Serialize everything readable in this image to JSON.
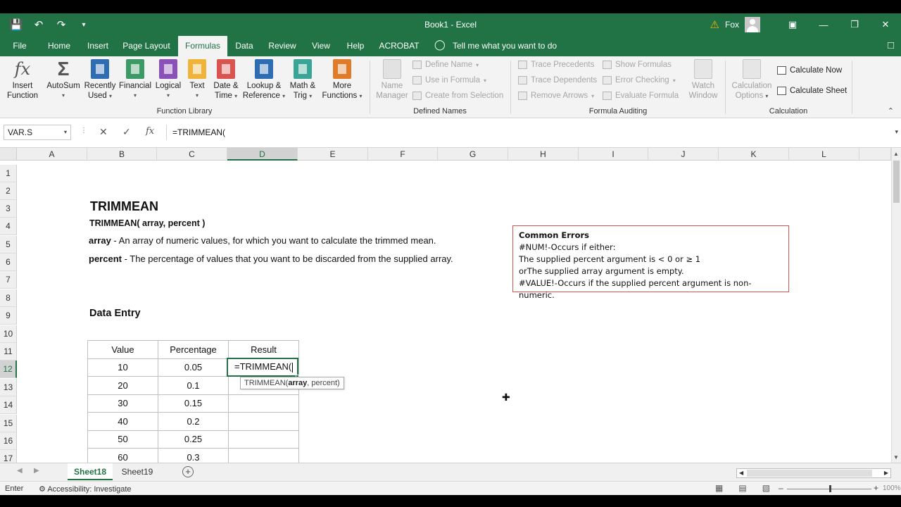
{
  "window": {
    "title": "Book1  -  Excel",
    "user": "Fox"
  },
  "tabs": [
    "File",
    "Home",
    "Insert",
    "Page Layout",
    "Formulas",
    "Data",
    "Review",
    "View",
    "Help",
    "ACROBAT"
  ],
  "active_tab": "Formulas",
  "tell_me": "Tell me what you want to do",
  "ribbon": {
    "function_library": {
      "label": "Function Library",
      "buttons": [
        {
          "line1": "Insert",
          "line2": "Function",
          "icon": "fx-icon"
        },
        {
          "line1": "AutoSum",
          "line2": "",
          "icon": "sigma-icon"
        },
        {
          "line1": "Recently",
          "line2": "Used",
          "icon": "star-book-icon",
          "color": "#2f6db3"
        },
        {
          "line1": "Financial",
          "line2": "",
          "icon": "financial-book-icon",
          "color": "#3c9a66"
        },
        {
          "line1": "Logical",
          "line2": "",
          "icon": "logical-book-icon",
          "color": "#8a52b8"
        },
        {
          "line1": "Text",
          "line2": "",
          "icon": "text-book-icon",
          "color": "#f0b43a"
        },
        {
          "line1": "Date &",
          "line2": "Time",
          "icon": "calendar-book-icon",
          "color": "#d9534f"
        },
        {
          "line1": "Lookup &",
          "line2": "Reference",
          "icon": "lookup-book-icon",
          "color": "#2f6db3"
        },
        {
          "line1": "Math &",
          "line2": "Trig",
          "icon": "theta-book-icon",
          "color": "#3aa596"
        },
        {
          "line1": "More",
          "line2": "Functions",
          "icon": "more-book-icon",
          "color": "#e07b2a"
        }
      ]
    },
    "defined_names": {
      "label": "Defined Names",
      "name_manager": {
        "line1": "Name",
        "line2": "Manager"
      },
      "items": [
        "Define Name",
        "Use in Formula",
        "Create from Selection"
      ]
    },
    "formula_auditing": {
      "label": "Formula Auditing",
      "items_left": [
        "Trace Precedents",
        "Trace Dependents",
        "Remove Arrows"
      ],
      "items_right": [
        "Show Formulas",
        "Error Checking",
        "Evaluate Formula"
      ],
      "watch": {
        "line1": "Watch",
        "line2": "Window"
      }
    },
    "calculation": {
      "label": "Calculation",
      "options": {
        "line1": "Calculation",
        "line2": "Options"
      },
      "calc_now": "Calculate Now",
      "calc_sheet": "Calculate Sheet"
    }
  },
  "formula_bar": {
    "name_box": "VAR.S",
    "formula": "=TRIMMEAN("
  },
  "columns": [
    "A",
    "B",
    "C",
    "D",
    "E",
    "F",
    "G",
    "H",
    "I",
    "J",
    "K",
    "L"
  ],
  "selected_column": "D",
  "rows": [
    "1",
    "2",
    "3",
    "4",
    "5",
    "6",
    "7",
    "8",
    "9",
    "10",
    "11",
    "12",
    "13",
    "14",
    "15",
    "16",
    "17"
  ],
  "selected_row": "12",
  "sheet": {
    "title": "TRIMMEAN",
    "syntax": "TRIMMEAN( array, percent )",
    "arg1_name": "array",
    "arg1_desc": " - An array of numeric values, for which you want to calculate the trimmed mean.",
    "arg2_name": "percent",
    "arg2_desc": " - The percentage of values that you want to be discarded from the supplied array.",
    "data_entry": "Data Entry",
    "common_errors": {
      "title": "Common Errors",
      "lines": [
        "#NUM!-Occurs if either:",
        "The supplied percent argument is < 0 or ≥ 1",
        "orThe supplied array argument is empty.",
        "#VALUE!-Occurs if the supplied percent argument is non-numeric."
      ]
    },
    "table": {
      "headers": [
        "Value",
        "Percentage",
        "Result"
      ],
      "rows": [
        [
          "10",
          "0.05",
          ""
        ],
        [
          "20",
          "0.1",
          ""
        ],
        [
          "30",
          "0.15",
          ""
        ],
        [
          "40",
          "0.2",
          ""
        ],
        [
          "50",
          "0.25",
          ""
        ],
        [
          "60",
          "0.3",
          ""
        ]
      ]
    },
    "active_cell_text": "=TRIMMEAN(",
    "tooltip": {
      "fn": "TRIMMEAN(",
      "arg_bold": "array",
      "rest": ", percent)"
    }
  },
  "sheet_tabs": [
    "Sheet18",
    "Sheet19"
  ],
  "active_sheet": "Sheet18",
  "status": {
    "mode": "Enter",
    "accessibility": "Accessibility: Investigate",
    "zoom": "100%"
  }
}
